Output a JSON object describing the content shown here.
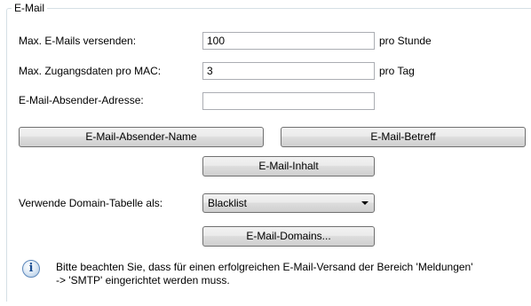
{
  "group": {
    "title": "E-Mail"
  },
  "rows": {
    "max_emails": {
      "label": "Max. E-Mails versenden:",
      "value": "100",
      "unit": "pro Stunde"
    },
    "max_credentials": {
      "label": "Max. Zugangsdaten pro MAC:",
      "value": "3",
      "unit": "pro Tag"
    },
    "sender_address": {
      "label": "E-Mail-Absender-Adresse:",
      "value": ""
    }
  },
  "buttons": {
    "sender_name": "E-Mail-Absender-Name",
    "subject": "E-Mail-Betreff",
    "content": "E-Mail-Inhalt",
    "domains": "E-Mail-Domains..."
  },
  "domain_table": {
    "label": "Verwende Domain-Tabelle als:",
    "selected": "Blacklist"
  },
  "info": {
    "icon": "info-icon",
    "line1": "Bitte beachten Sie, dass für einen erfolgreichen E-Mail-Versand der Bereich 'Meldungen'",
    "line2": "-> 'SMTP' eingerichtet werden muss."
  }
}
